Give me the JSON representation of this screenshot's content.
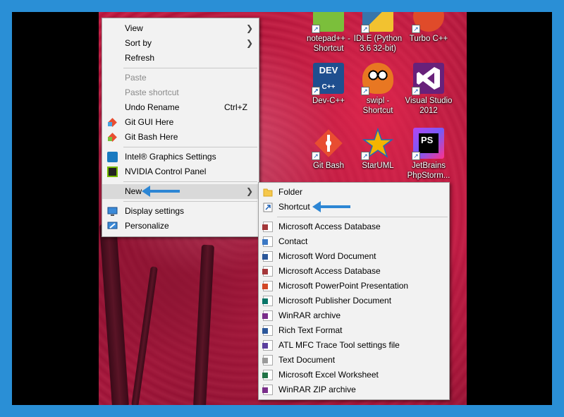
{
  "desktop_icons": [
    {
      "id": "notepadpp",
      "label_line1": "notepad++ -",
      "label_line2": "Shortcut",
      "icon": "notepadpp-icon",
      "color": "#7bbf3b"
    },
    {
      "id": "idle",
      "label_line1": "IDLE (Python",
      "label_line2": "3.6 32-bit)",
      "icon": "python-idle-icon",
      "color": "#f2c230"
    },
    {
      "id": "turboc",
      "label_line1": "Turbo C++",
      "label_line2": "",
      "icon": "turbo-cpp-icon",
      "color": "#e04b2a"
    },
    {
      "id": "devcpp",
      "label_line1": "Dev-C++",
      "label_line2": "",
      "icon": "dev-cpp-icon",
      "color": "#1f4f8f"
    },
    {
      "id": "swipl",
      "label_line1": "swipl -",
      "label_line2": "Shortcut",
      "icon": "swipl-owl-icon",
      "color": "#e87722"
    },
    {
      "id": "vs2012",
      "label_line1": "Visual Studio",
      "label_line2": "2012",
      "icon": "visual-studio-icon",
      "color": "#68217a"
    },
    {
      "id": "gitbash",
      "label_line1": "Git Bash",
      "label_line2": "",
      "icon": "git-bash-icon",
      "color": "#e84d31"
    },
    {
      "id": "staruml",
      "label_line1": "StarUML",
      "label_line2": "",
      "icon": "staruml-icon",
      "color": "#f5b400"
    },
    {
      "id": "phpstorm",
      "label_line1": "JetBrains",
      "label_line2": "PhpStorm...",
      "icon": "phpstorm-icon",
      "color": "#8f3fd6"
    }
  ],
  "context_menu": {
    "view": "View",
    "sort_by": "Sort by",
    "refresh": "Refresh",
    "paste": "Paste",
    "paste_shortcut": "Paste shortcut",
    "undo_rename": "Undo Rename",
    "undo_rename_key": "Ctrl+Z",
    "git_gui": "Git GUI Here",
    "git_bash": "Git Bash Here",
    "intel_graphics": "Intel® Graphics Settings",
    "nvidia": "NVIDIA Control Panel",
    "new": "New",
    "display_settings": "Display settings",
    "personalize": "Personalize"
  },
  "new_submenu": {
    "folder": "Folder",
    "shortcut": "Shortcut",
    "items": [
      {
        "label": "Microsoft Access Database",
        "icon": "access-icon",
        "color": "#a4373a"
      },
      {
        "label": "Contact",
        "icon": "contact-icon",
        "color": "#3b78c4"
      },
      {
        "label": "Microsoft Word Document",
        "icon": "word-icon",
        "color": "#2b579a"
      },
      {
        "label": "Microsoft Access Database",
        "icon": "access-icon",
        "color": "#a4373a"
      },
      {
        "label": "Microsoft PowerPoint Presentation",
        "icon": "powerpoint-icon",
        "color": "#d24726"
      },
      {
        "label": "Microsoft Publisher Document",
        "icon": "publisher-icon",
        "color": "#077568"
      },
      {
        "label": "WinRAR archive",
        "icon": "winrar-icon",
        "color": "#7a2e8a"
      },
      {
        "label": "Rich Text Format",
        "icon": "rtf-icon",
        "color": "#2b579a"
      },
      {
        "label": "ATL MFC Trace Tool settings file",
        "icon": "atl-trace-icon",
        "color": "#5b3f9e"
      },
      {
        "label": "Text Document",
        "icon": "text-document-icon",
        "color": "#9a9a9a"
      },
      {
        "label": "Microsoft Excel Worksheet",
        "icon": "excel-icon",
        "color": "#217346"
      },
      {
        "label": "WinRAR ZIP archive",
        "icon": "winrar-zip-icon",
        "color": "#7a2e8a"
      }
    ]
  },
  "colors": {
    "frame": "#2a8fd6",
    "arrow": "#2d86d4",
    "menu_bg": "#f2f2f2",
    "hover": "#d9d9d9"
  }
}
